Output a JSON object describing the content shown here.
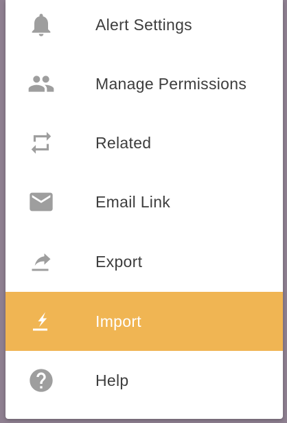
{
  "menu": {
    "items": [
      {
        "label": "Alert Settings",
        "icon": "bell-icon"
      },
      {
        "label": "Manage Permissions",
        "icon": "people-icon"
      },
      {
        "label": "Related",
        "icon": "repeat-icon"
      },
      {
        "label": "Email Link",
        "icon": "envelope-icon"
      },
      {
        "label": "Export",
        "icon": "share-arrow-icon"
      },
      {
        "label": "Import",
        "icon": "import-icon",
        "active": true
      },
      {
        "label": "Help",
        "icon": "help-icon"
      }
    ]
  },
  "colors": {
    "background": "#8e7f90",
    "menu_bg": "#ffffff",
    "active_bg": "#f0b553",
    "icon": "#9e9e9e",
    "text": "#3d3d3d",
    "active_text": "#ffffff"
  }
}
